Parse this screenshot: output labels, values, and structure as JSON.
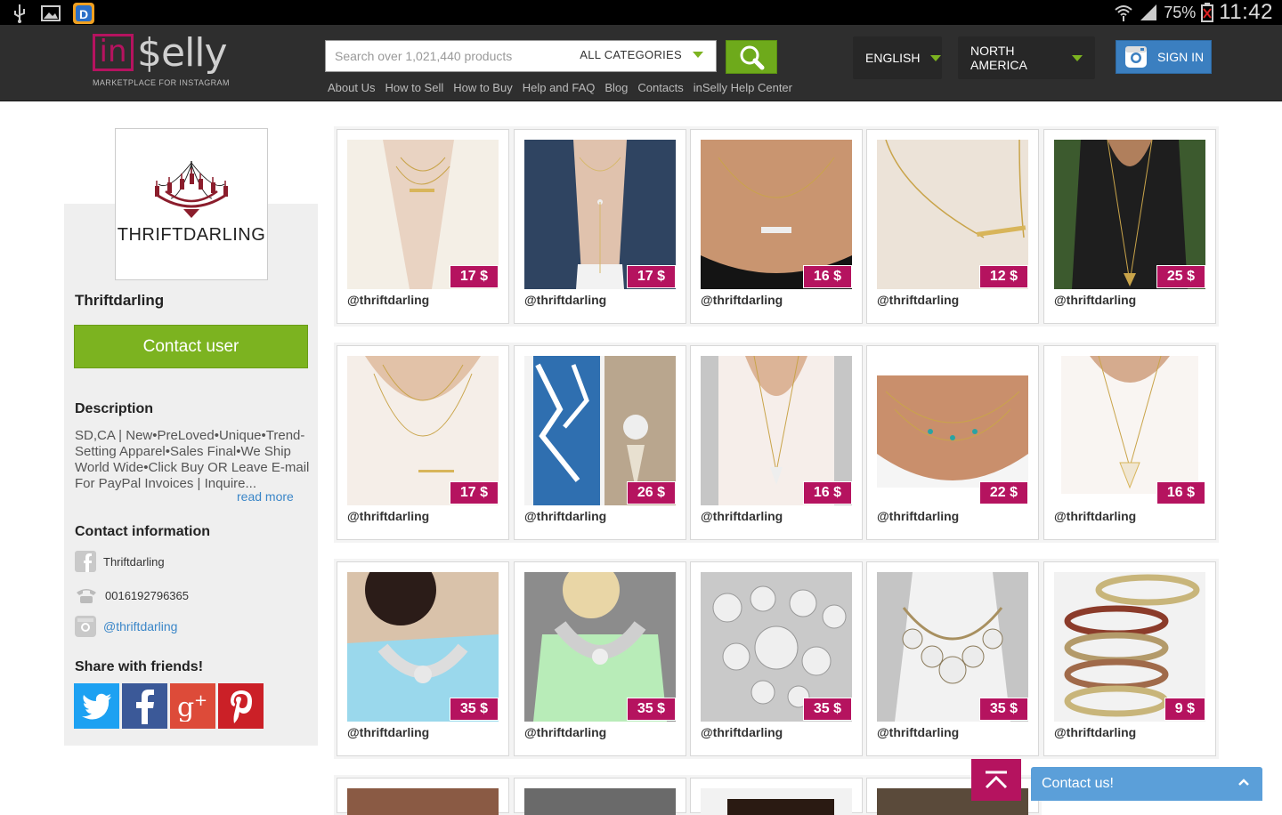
{
  "status_bar": {
    "battery": "75%",
    "time": "11:42",
    "icons": [
      "usb-icon",
      "gallery-icon",
      "app-d-icon",
      "wifi-icon",
      "signal-icon",
      "battery-icon"
    ]
  },
  "header": {
    "logo_in": "in",
    "logo_selly": "$elly",
    "logo_tagline": "MARKETPLACE FOR INSTAGRAM",
    "search_placeholder": "Search over 1,021,440 products",
    "category": "ALL CATEGORIES",
    "nav_links": [
      "About Us",
      "How to Sell",
      "How to Buy",
      "Help and FAQ",
      "Blog",
      "Contacts",
      "inSelly Help Center"
    ],
    "language": "ENGLISH",
    "region": "NORTH AMERICA",
    "sign_in": "SIGN IN",
    "accent_green": "#7cb320",
    "accent_magenta": "#b5135f"
  },
  "profile": {
    "avatar_text": "THRIFTDARLING",
    "username": "Thriftdarling",
    "contact_button": "Contact user",
    "description_title": "Description",
    "description": "SD,CA | New•PreLoved•Unique•Trend-Setting Apparel•Sales Final•We Ship World Wide•Click Buy OR Leave E-mail For PayPal Invoices | Inquire...",
    "read_more": "read more",
    "contact_title": "Contact information",
    "facebook_name": "Thriftdarling",
    "phone": "0016192796365",
    "instagram": "@thriftdarling",
    "share_title": "Share with friends!",
    "share_buttons": [
      "twitter-icon",
      "facebook-icon",
      "google-plus-icon",
      "pinterest-icon"
    ]
  },
  "products": [
    {
      "price": "17 $",
      "seller": "@thriftdarling"
    },
    {
      "price": "17 $",
      "seller": "@thriftdarling"
    },
    {
      "price": "16 $",
      "seller": "@thriftdarling"
    },
    {
      "price": "12 $",
      "seller": "@thriftdarling"
    },
    {
      "price": "25 $",
      "seller": "@thriftdarling"
    },
    {
      "price": "17 $",
      "seller": "@thriftdarling"
    },
    {
      "price": "26 $",
      "seller": "@thriftdarling"
    },
    {
      "price": "16 $",
      "seller": "@thriftdarling"
    },
    {
      "price": "22 $",
      "seller": "@thriftdarling"
    },
    {
      "price": "16 $",
      "seller": "@thriftdarling"
    },
    {
      "price": "35 $",
      "seller": "@thriftdarling"
    },
    {
      "price": "35 $",
      "seller": "@thriftdarling"
    },
    {
      "price": "35 $",
      "seller": "@thriftdarling"
    },
    {
      "price": "35 $",
      "seller": "@thriftdarling"
    },
    {
      "price": "9 $",
      "seller": "@thriftdarling"
    }
  ],
  "contact_us": "Contact us!"
}
